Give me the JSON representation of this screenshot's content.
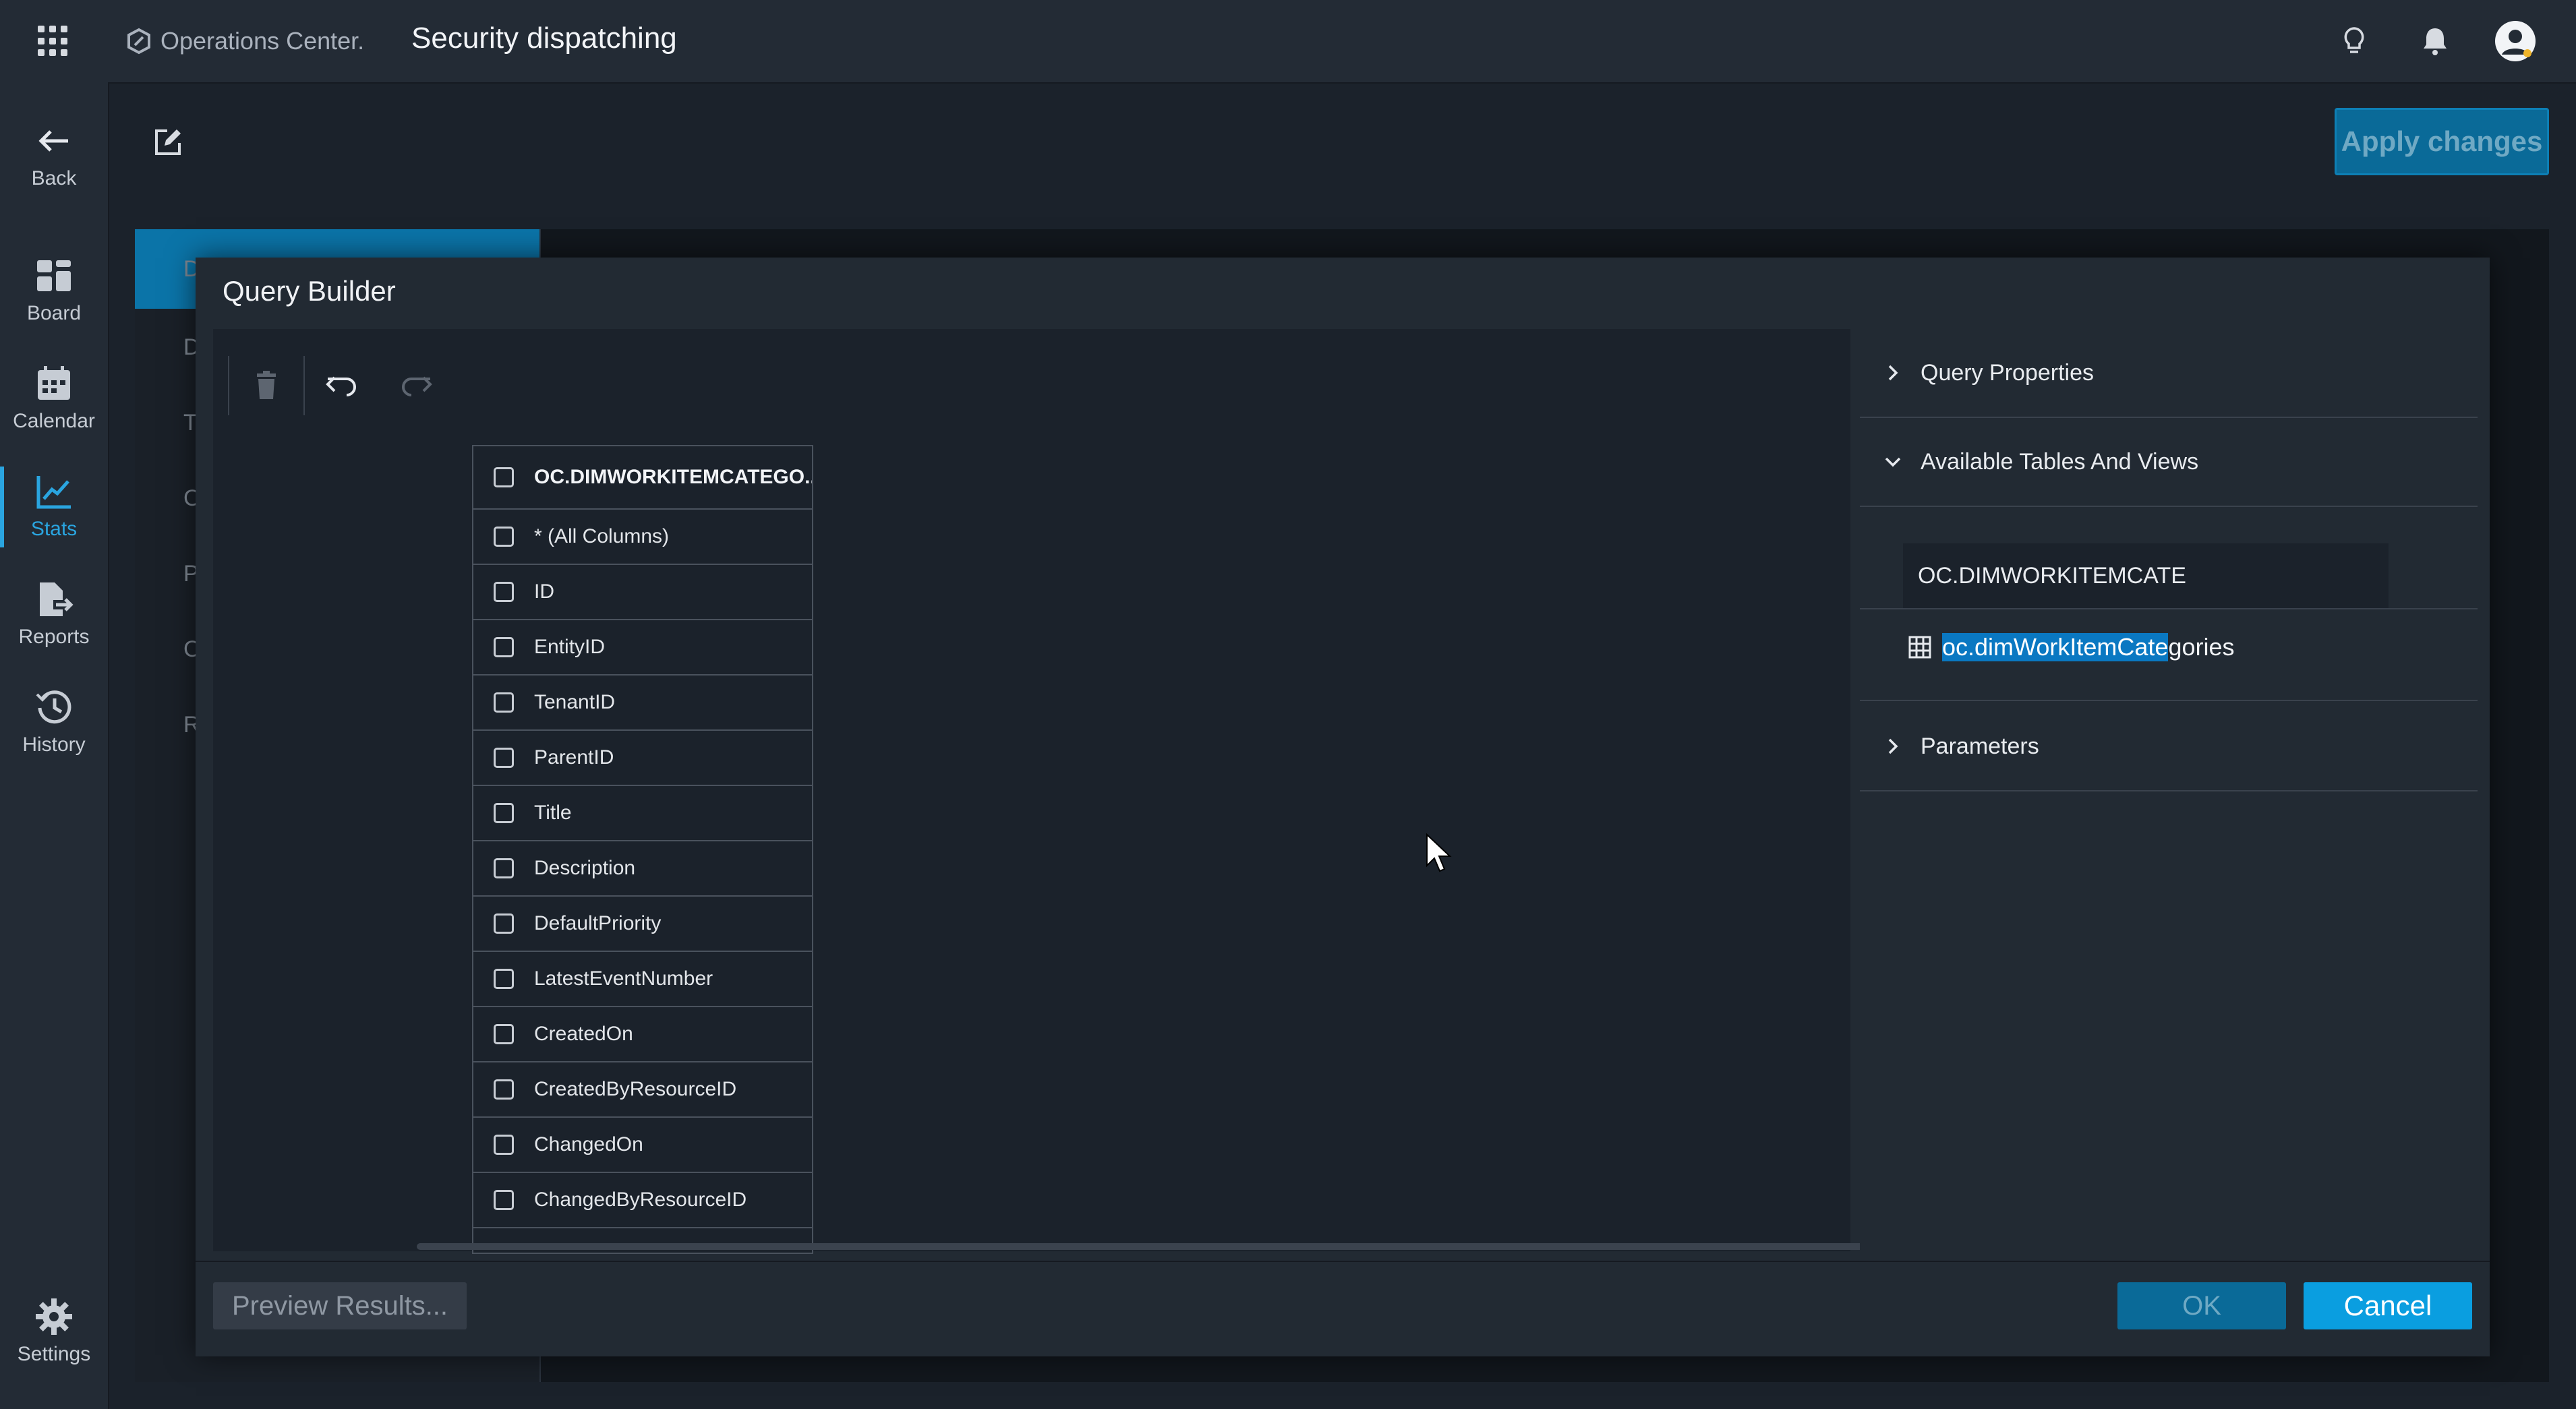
{
  "app": {
    "brand": "Operations Center.",
    "title": "Security dispatching"
  },
  "nav": {
    "back": "Back",
    "board": "Board",
    "calendar": "Calendar",
    "stats": "Stats",
    "reports": "Reports",
    "history": "History",
    "settings": "Settings"
  },
  "page": {
    "apply_label": "Apply changes",
    "under_letters": [
      "D",
      "D",
      "T",
      "C",
      "P",
      "C",
      "R"
    ]
  },
  "dialog": {
    "title": "Query Builder",
    "table": {
      "name": "OC.DIMWORKITEMCATEGO...",
      "columns": [
        "* (All Columns)",
        "ID",
        "EntityID",
        "TenantID",
        "ParentID",
        "Title",
        "Description",
        "DefaultPriority",
        "LatestEventNumber",
        "CreatedOn",
        "CreatedByResourceID",
        "ChangedOn",
        "ChangedByResourceID"
      ]
    },
    "panel": {
      "query_properties": "Query Properties",
      "available_tables": "Available Tables And Views",
      "search_value": "OC.DIMWORKITEMCATE",
      "result_highlight": "oc.dimWorkItemCate",
      "result_rest": "gories",
      "parameters": "Parameters"
    },
    "footer": {
      "preview": "Preview Results...",
      "ok": "OK",
      "cancel": "Cancel"
    }
  },
  "colors": {
    "accent": "#0a9ee0",
    "active_nav": "#2aa5e0",
    "highlight": "#0a78c2"
  }
}
